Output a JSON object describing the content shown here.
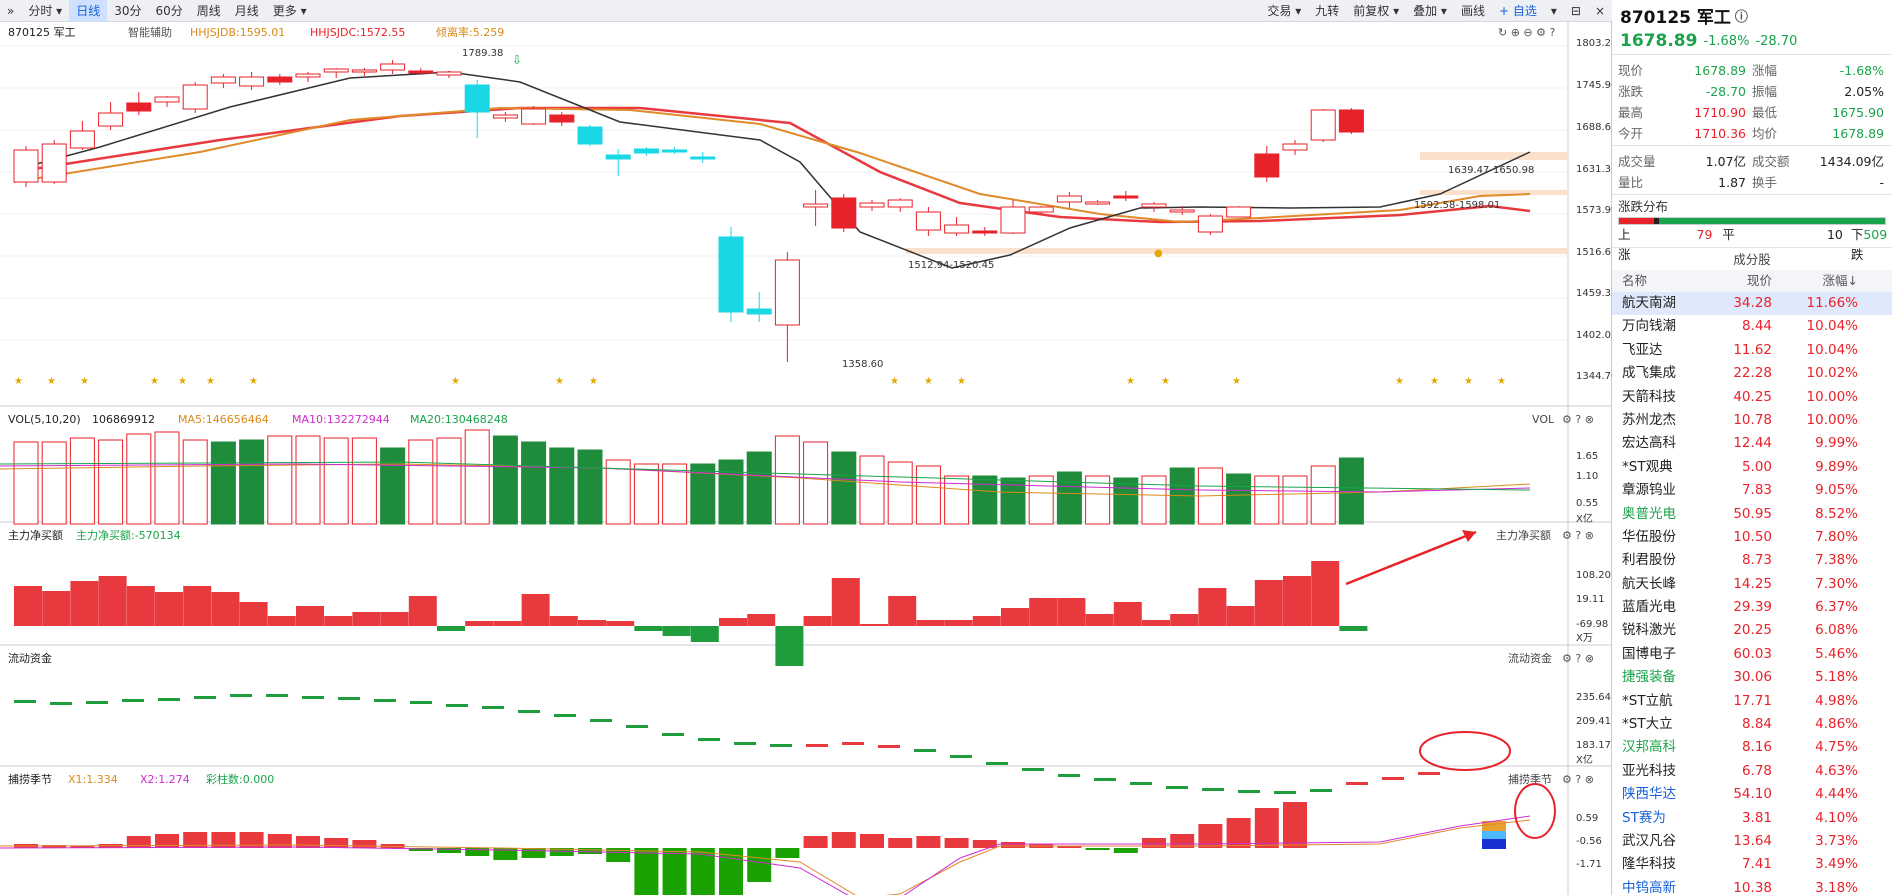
{
  "toolbar": {
    "left": [
      "»",
      "分时 ▾",
      "日线",
      "30分",
      "60分",
      "周线",
      "月线",
      "更多 ▾"
    ],
    "active": "日线",
    "right": [
      "交易 ▾",
      "九转",
      "前复权 ▾",
      "叠加 ▾",
      "画线",
      "+ 自选",
      "▾",
      "⊟",
      "×"
    ]
  },
  "main": {
    "legend": {
      "code": "870125 军工",
      "assist": "智能辅助",
      "l1": "HHJSJDB:1595.01",
      "l2": "HHJSJDC:1572.55",
      "l3": "倾离率:5.259"
    },
    "yticks": [
      "1803.28",
      "1745.96",
      "1688.63",
      "1631.31",
      "1573.99",
      "1516.67",
      "1459.35",
      "1402.02",
      "1344.70"
    ],
    "annotations": {
      "high": "1789.38",
      "low": "1358.60",
      "r1": "1512.94-1520.45",
      "r2": "1639.47-1650.98",
      "r3": "1592.58-1598.01"
    }
  },
  "vol": {
    "title": "VOL(5,10,20)",
    "v": "106869912",
    "ma5": "MA5:146656464",
    "ma10": "MA10:132272944",
    "ma20": "MA20:130468248",
    "tag": "VOL",
    "yticks": [
      "1.65",
      "1.10",
      "0.55"
    ],
    "unit": "X亿"
  },
  "net": {
    "title": "主力净买额",
    "val": "主力净买额:-570134",
    "tag": "主力净买额",
    "yticks": [
      "108.20",
      "19.11",
      "-69.98"
    ],
    "unit": "X万"
  },
  "flow": {
    "title": "流动资金",
    "tag": "流动资金",
    "yticks": [
      "235.64",
      "209.41",
      "183.17"
    ],
    "unit": "X亿"
  },
  "season": {
    "title": "捕捞季节",
    "x1": "X1:1.334",
    "x2": "X2:1.274",
    "cz": "彩柱数:0.000",
    "tag": "捕捞季节",
    "yticks": [
      "0.59",
      "-0.56",
      "-1.71"
    ]
  },
  "quote": {
    "title": "870125 军工",
    "price": "1678.89",
    "chg_pct": "-1.68%",
    "chg": "-28.70",
    "rows": [
      [
        "现价",
        "1678.89",
        "涨幅",
        "-1.68%"
      ],
      [
        "涨跌",
        "-28.70",
        "振幅",
        "2.05%"
      ],
      [
        "最高",
        "1710.90",
        "最低",
        "1675.90"
      ],
      [
        "今开",
        "1710.36",
        "均价",
        "1678.89"
      ]
    ],
    "rows2": [
      [
        "成交量",
        "1.07亿",
        "成交额",
        "1434.09亿"
      ],
      [
        "量比",
        "1.87",
        "换手",
        "-"
      ]
    ]
  },
  "dist": {
    "title": "涨跌分布",
    "up_label": "上涨",
    "up": "79",
    "flat_label": "平",
    "flat": "10",
    "down_label": "下跌",
    "down": "509"
  },
  "components": {
    "title": "成分股",
    "headers": [
      "名称",
      "现价",
      "涨幅↓"
    ],
    "rows": [
      [
        "航天南湖",
        "34.28",
        "11.66%"
      ],
      [
        "万向钱潮",
        "8.44",
        "10.04%"
      ],
      [
        "飞亚达",
        "11.62",
        "10.04%"
      ],
      [
        "成飞集成",
        "22.28",
        "10.02%"
      ],
      [
        "天箭科技",
        "40.25",
        "10.00%"
      ],
      [
        "苏州龙杰",
        "10.78",
        "10.00%"
      ],
      [
        "宏达高科",
        "12.44",
        "9.99%"
      ],
      [
        "*ST观典",
        "5.00",
        "9.89%"
      ],
      [
        "章源钨业",
        "7.83",
        "9.05%"
      ],
      [
        "奥普光电",
        "50.95",
        "8.52%"
      ],
      [
        "华伍股份",
        "10.50",
        "7.80%"
      ],
      [
        "利君股份",
        "8.73",
        "7.38%"
      ],
      [
        "航天长峰",
        "14.25",
        "7.30%"
      ],
      [
        "蓝盾光电",
        "29.39",
        "6.37%"
      ],
      [
        "锐科激光",
        "20.25",
        "6.08%"
      ],
      [
        "国博电子",
        "60.03",
        "5.46%"
      ],
      [
        "捷强装备",
        "30.06",
        "5.18%"
      ],
      [
        "*ST立航",
        "17.71",
        "4.98%"
      ],
      [
        "*ST大立",
        "8.84",
        "4.86%"
      ],
      [
        "汉邦高科",
        "8.16",
        "4.75%"
      ],
      [
        "亚光科技",
        "6.78",
        "4.63%"
      ],
      [
        "陕西华达",
        "54.10",
        "4.44%"
      ],
      [
        "ST赛为",
        "3.81",
        "4.10%"
      ],
      [
        "武汉凡谷",
        "13.64",
        "3.73%"
      ],
      [
        "隆华科技",
        "7.41",
        "3.49%"
      ],
      [
        "中钨高新",
        "10.38",
        "3.18%"
      ]
    ]
  }
}
